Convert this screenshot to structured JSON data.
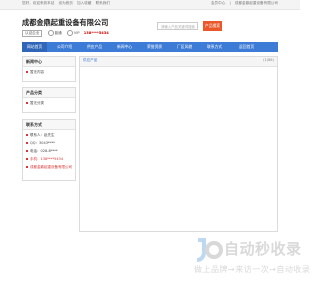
{
  "topbar": {
    "left_links": [
      "您好，欢迎来到本站",
      "设为首页",
      "加入收藏",
      "联系我们"
    ],
    "right_links": [
      "会员中心",
      "|",
      "成都金鼎起重设备有限公司"
    ]
  },
  "header": {
    "company_name": "成都金鼎起重设备有限公司",
    "badge": "认证企业",
    "option1": "普通",
    "option2": "VIP",
    "phone": "138****5434",
    "search_placeholder": "请输入产品关键词搜索",
    "search_button": "产品搜索"
  },
  "nav": {
    "items": [
      "网站首页",
      "公司介绍",
      "供应产品",
      "新闻中心",
      "荣誉资质",
      "厂区风貌",
      "联系方式",
      "返回首页"
    ]
  },
  "sidebar": {
    "news": {
      "title": "新闻中心",
      "items": [
        "暂无内容"
      ]
    },
    "products": {
      "title": "产品分类",
      "items": [
        "暂无分类"
      ]
    },
    "contact": {
      "title": "联系方式",
      "items": [
        "联系人：赵先生",
        "QQ：3043****",
        "电话：028-8****",
        "手机：138****5434",
        "成都金鼎起重设备有限公司"
      ]
    }
  },
  "main": {
    "breadcrumb": "供应产品",
    "count": "(1/88)"
  },
  "watermark": {
    "logo": "自动秒收录",
    "tagline": "做上品牌→来访一次→自动收录"
  },
  "colors": {
    "nav_bg": "#3c7bd6",
    "accent_orange": "#e9572b",
    "phone_red": "#cc0000"
  }
}
